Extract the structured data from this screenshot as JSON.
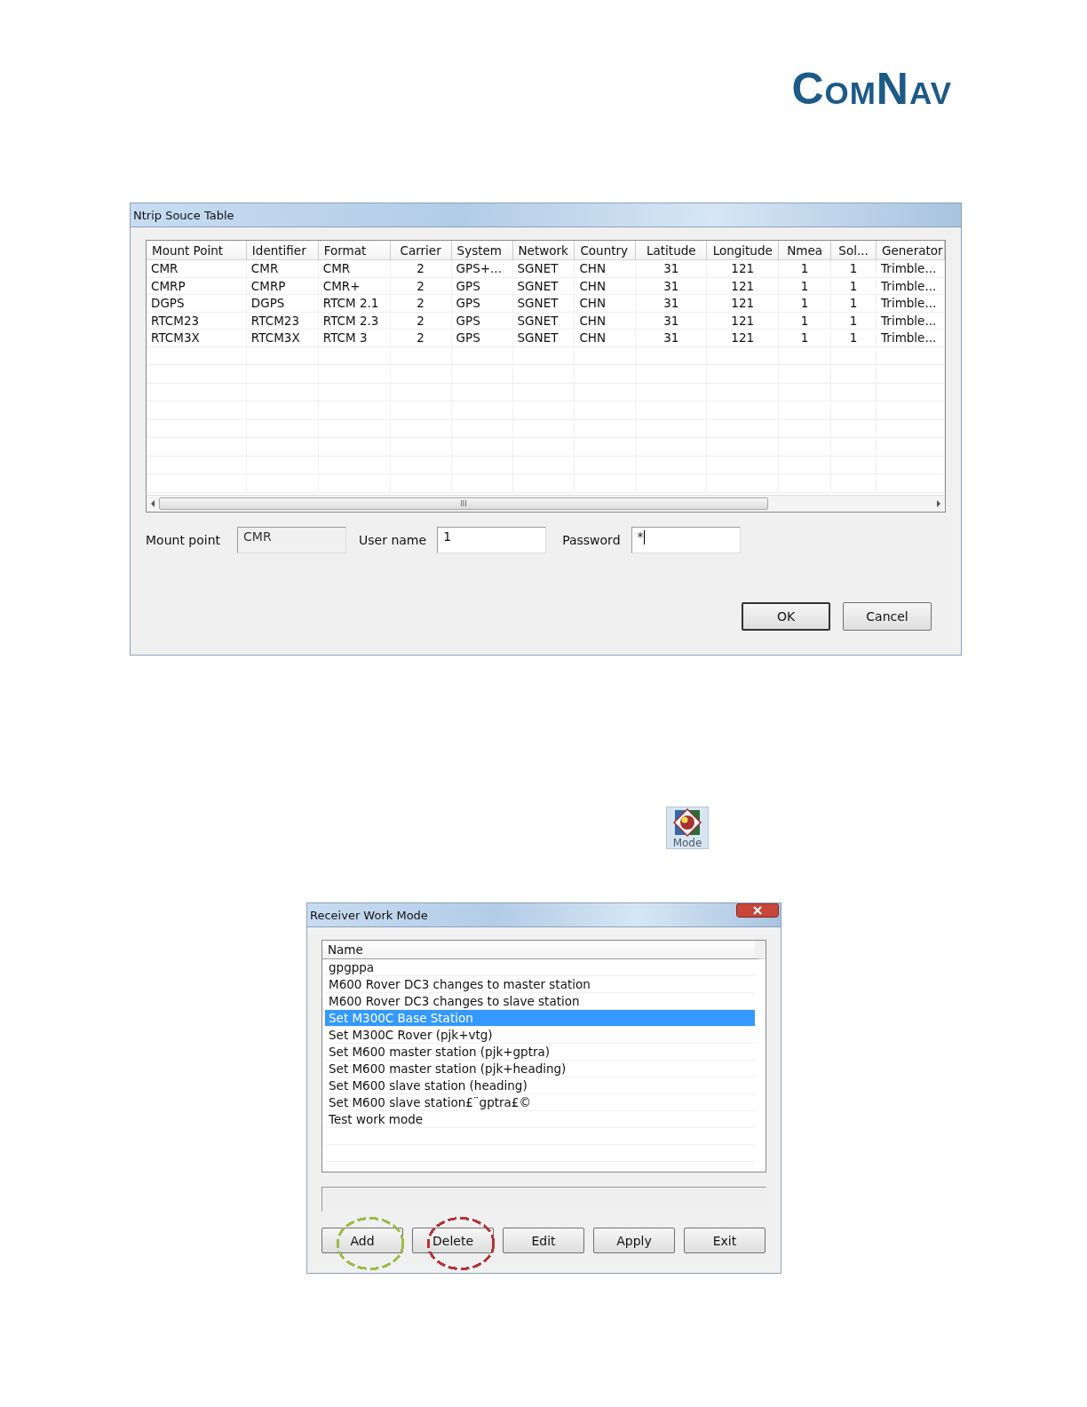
{
  "logo": {
    "text": "ComNav"
  },
  "ntrip_dialog": {
    "title": "Ntrip Souce Table",
    "columns": [
      {
        "label": "Mount Point",
        "kind": "text"
      },
      {
        "label": "Identifier",
        "kind": "text"
      },
      {
        "label": "Format",
        "kind": "text"
      },
      {
        "label": "Carrier",
        "kind": "number"
      },
      {
        "label": "System",
        "kind": "text"
      },
      {
        "label": "Network",
        "kind": "text"
      },
      {
        "label": "Country",
        "kind": "text"
      },
      {
        "label": "Latitude",
        "kind": "number"
      },
      {
        "label": "Longitude",
        "kind": "number"
      },
      {
        "label": "Nmea",
        "kind": "number"
      },
      {
        "label": "Sol...",
        "kind": "number"
      },
      {
        "label": "Generator",
        "kind": "text"
      }
    ],
    "rows": [
      [
        "CMR",
        "CMR",
        "CMR",
        "2",
        "GPS+...",
        "SGNET",
        "CHN",
        "31",
        "121",
        "1",
        "1",
        "Trimble..."
      ],
      [
        "CMRP",
        "CMRP",
        "CMR+",
        "2",
        "GPS",
        "SGNET",
        "CHN",
        "31",
        "121",
        "1",
        "1",
        "Trimble..."
      ],
      [
        "DGPS",
        "DGPS",
        "RTCM 2.1",
        "2",
        "GPS",
        "SGNET",
        "CHN",
        "31",
        "121",
        "1",
        "1",
        "Trimble..."
      ],
      [
        "RTCM23",
        "RTCM23",
        "RTCM 2.3",
        "2",
        "GPS",
        "SGNET",
        "CHN",
        "31",
        "121",
        "1",
        "1",
        "Trimble..."
      ],
      [
        "RTCM3X",
        "RTCM3X",
        "RTCM 3",
        "2",
        "GPS",
        "SGNET",
        "CHN",
        "31",
        "121",
        "1",
        "1",
        "Trimble..."
      ]
    ],
    "scrollbar_grip": "III",
    "fields": [
      {
        "label": "Mount point",
        "value": "CMR",
        "disabled": true
      },
      {
        "label": "User name",
        "value": "1",
        "disabled": false
      },
      {
        "label": "Password",
        "value": "*",
        "disabled": false
      }
    ],
    "buttons": [
      {
        "label": "OK",
        "default": true
      },
      {
        "label": "Cancel",
        "default": false
      }
    ]
  },
  "mode_button": {
    "label": "Mode"
  },
  "work_mode_dialog": {
    "title": "Receiver Work Mode",
    "column": "Name",
    "items": [
      {
        "label": "gpgppa",
        "selected": false
      },
      {
        "label": "M600 Rover DC3 changes to master station",
        "selected": false
      },
      {
        "label": "M600 Rover DC3 changes to slave station",
        "selected": false
      },
      {
        "label": "Set M300C Base Station",
        "selected": true
      },
      {
        "label": "Set M300C Rover (pjk+vtg)",
        "selected": false
      },
      {
        "label": "Set M600 master station (pjk+gptra)",
        "selected": false
      },
      {
        "label": "Set M600 master station (pjk+heading)",
        "selected": false
      },
      {
        "label": "Set M600 slave station (heading)",
        "selected": false
      },
      {
        "label": "Set M600 slave station£¨gptra£©",
        "selected": false
      },
      {
        "label": "Test work mode",
        "selected": false
      }
    ],
    "buttons": [
      {
        "label": "Add",
        "color": "#9cbb4a"
      },
      {
        "label": "Delete",
        "color": "#b5323a"
      },
      {
        "label": "Edit"
      },
      {
        "label": "Apply"
      },
      {
        "label": "Exit"
      }
    ]
  }
}
